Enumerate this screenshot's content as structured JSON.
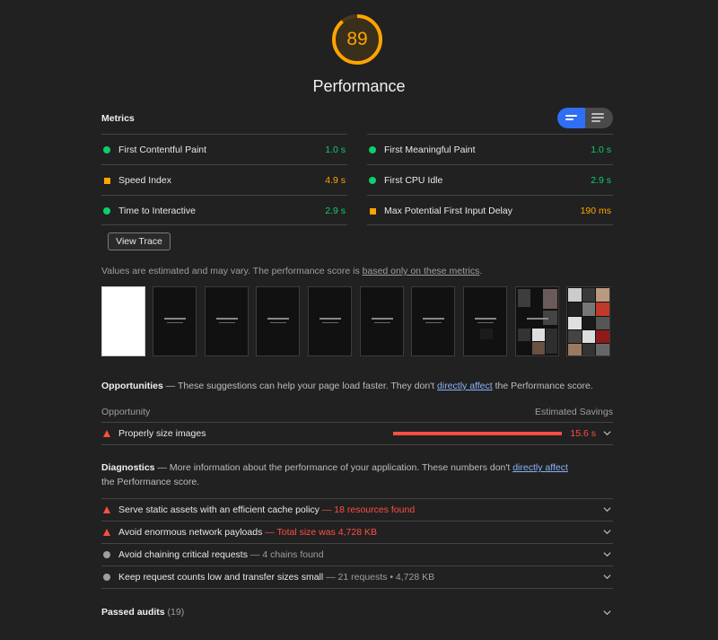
{
  "gauge": {
    "score": "89",
    "label": "Performance",
    "score_fraction": 0.89,
    "color": "#ffa400"
  },
  "metrics": {
    "title": "Metrics",
    "left": [
      {
        "name": "First Contentful Paint",
        "value": "1.0 s",
        "status": "pass"
      },
      {
        "name": "Speed Index",
        "value": "4.9 s",
        "status": "average"
      },
      {
        "name": "Time to Interactive",
        "value": "2.9 s",
        "status": "pass"
      }
    ],
    "right": [
      {
        "name": "First Meaningful Paint",
        "value": "1.0 s",
        "status": "pass"
      },
      {
        "name": "First CPU Idle",
        "value": "2.9 s",
        "status": "pass"
      },
      {
        "name": "Max Potential First Input Delay",
        "value": "190 ms",
        "status": "average"
      }
    ],
    "toggle": {
      "left_icon": "compact-view-icon",
      "right_icon": "expanded-view-icon",
      "selected": "left"
    }
  },
  "view_trace": "View Trace",
  "note": {
    "text": "Values are estimated and may vary. The performance score is ",
    "link": "based only on these metrics",
    "end": "."
  },
  "opportunities": {
    "title": "Opportunities",
    "dash": " — ",
    "desc": "These suggestions can help your page load faster. They don't ",
    "link": "directly affect",
    "desc_end": " the Performance score.",
    "col_left": "Opportunity",
    "col_right": "Estimated Savings",
    "items": [
      {
        "title": "Properly size images",
        "savings": "15.6 s"
      }
    ]
  },
  "diagnostics": {
    "title": "Diagnostics",
    "dash": " — ",
    "desc": "More information about the performance of your application. These numbers don't ",
    "link": "directly affect",
    "desc_end": " the Performance score.",
    "items": [
      {
        "title": "Serve static assets with an efficient cache policy",
        "sub": "18 resources found",
        "status": "fail"
      },
      {
        "title": "Avoid enormous network payloads",
        "sub": "Total size was 4,728 KB",
        "status": "fail"
      },
      {
        "title": "Avoid chaining critical requests",
        "sub": "4 chains found",
        "status": "info"
      },
      {
        "title": "Keep request counts low and transfer sizes small",
        "sub": "21 requests • 4,728 KB",
        "status": "info"
      }
    ]
  },
  "passed": {
    "label": "Passed audits",
    "count": "(19)"
  },
  "colors": {
    "pass": "#0cce6b",
    "average": "#ffa400",
    "fail": "#ff4e42",
    "accent": "#2f6ff5"
  }
}
